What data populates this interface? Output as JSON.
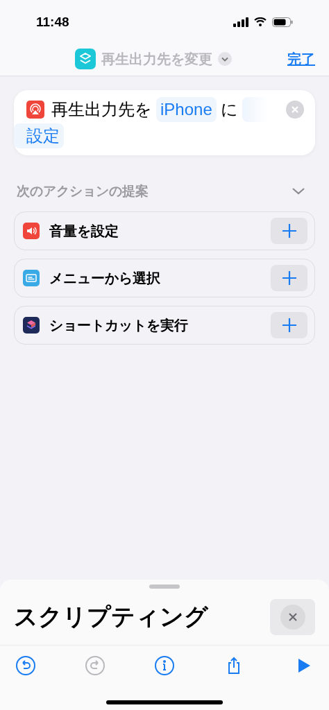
{
  "status_bar": {
    "time": "11:48"
  },
  "nav": {
    "title": "再生出力先を変更",
    "done": "完了"
  },
  "action": {
    "parts": [
      {
        "kind": "text",
        "text": "再生出力先を"
      },
      {
        "kind": "token",
        "text": "iPhone"
      },
      {
        "kind": "text",
        "text": "に"
      },
      {
        "kind": "blank"
      },
      {
        "kind": "token",
        "text": "設定"
      }
    ]
  },
  "suggestions": {
    "title": "次のアクションの提案",
    "expanded": true,
    "items": [
      {
        "kind": "volume",
        "label": "音量を設定",
        "color": "#f0453a"
      },
      {
        "kind": "menu",
        "label": "メニューから選択",
        "color": "#3aaae6"
      },
      {
        "kind": "shortcut",
        "label": "ショートカットを実行",
        "color": "#1e2a5a"
      }
    ]
  },
  "sheet": {
    "title": "スクリプティング"
  },
  "toolbar": [
    {
      "kind": "undo",
      "disabled": false
    },
    {
      "kind": "redo",
      "disabled": true
    },
    {
      "kind": "info",
      "disabled": false
    },
    {
      "kind": "share",
      "disabled": false
    },
    {
      "kind": "run",
      "disabled": false
    }
  ]
}
